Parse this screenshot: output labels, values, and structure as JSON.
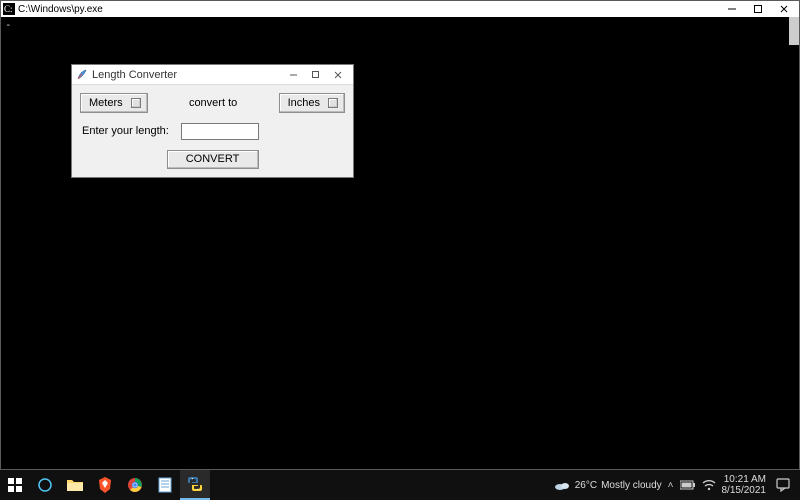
{
  "main_window": {
    "title": "C:\\Windows\\py.exe",
    "caret": "-"
  },
  "tk_dialog": {
    "title": "Length Converter",
    "from_unit": "Meters",
    "convert_to_label": "convert to",
    "to_unit": "Inches",
    "enter_label": "Enter your length:",
    "entry_value": "",
    "convert_button": "CONVERT"
  },
  "taskbar": {
    "weather_temp": "26°C",
    "weather_desc": "Mostly cloudy",
    "time": "10:21 AM",
    "date": "8/15/2021",
    "tray_chevron": "˄"
  },
  "colors": {
    "taskbar_bg": "#101010",
    "dialog_bg": "#f0f0f0"
  }
}
